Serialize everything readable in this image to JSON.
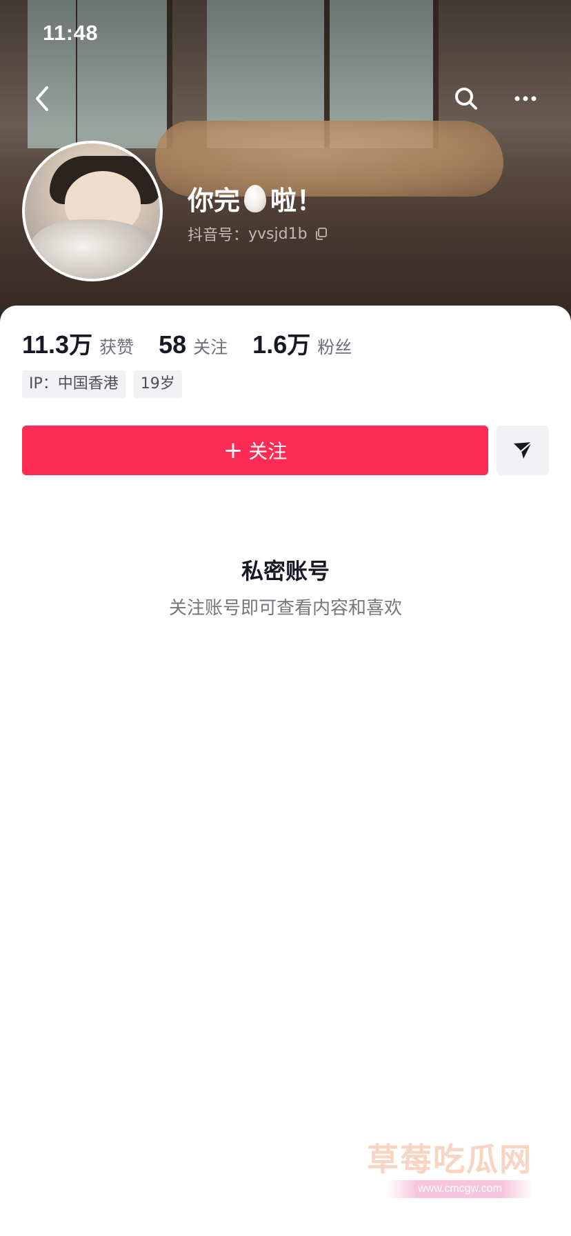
{
  "status_bar": {
    "time": "11:48"
  },
  "profile": {
    "nickname_before": "你完",
    "nickname_emoji": "egg",
    "nickname_after": "啦！",
    "douyin_id_label": "抖音号：",
    "douyin_id": "yvsjd1b"
  },
  "stats": [
    {
      "num": "11.3",
      "unit": "万",
      "label": "获赞"
    },
    {
      "num": "58",
      "unit": "",
      "label": "关注"
    },
    {
      "num": "1.6",
      "unit": "万",
      "label": "粉丝"
    }
  ],
  "tags": [
    "IP：中国香港",
    "19岁"
  ],
  "actions": {
    "follow_plus": "+",
    "follow_label": "关注"
  },
  "private_notice": {
    "title": "私密账号",
    "subtitle": "关注账号即可查看内容和喜欢"
  },
  "watermark": {
    "text": "草莓吃瓜网",
    "url": "www.cmcgw.com"
  },
  "colors": {
    "accent": "#fe2c55",
    "tag_bg": "#f2f2f4",
    "muted_text": "#75767d"
  },
  "icons": {
    "back": "chevron-left-icon",
    "search": "search-icon",
    "more": "more-icon",
    "copy": "copy-icon",
    "share": "send-icon"
  }
}
